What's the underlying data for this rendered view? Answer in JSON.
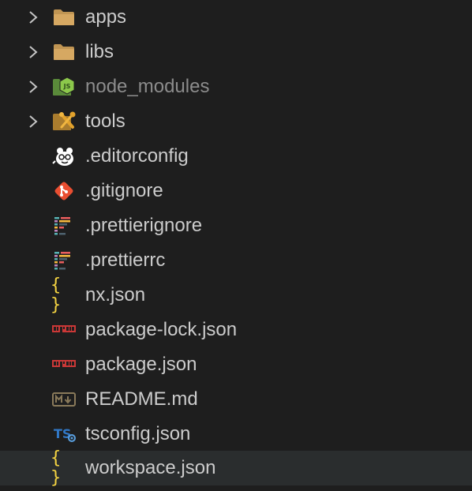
{
  "tree": {
    "items": [
      {
        "label": "apps",
        "kind": "folder",
        "icon": "folder-icon",
        "expandable": true,
        "dimmed": false,
        "selected": false
      },
      {
        "label": "libs",
        "kind": "folder",
        "icon": "folder-icon",
        "expandable": true,
        "dimmed": false,
        "selected": false
      },
      {
        "label": "node_modules",
        "kind": "folder",
        "icon": "node-folder-icon",
        "expandable": true,
        "dimmed": true,
        "selected": false
      },
      {
        "label": "tools",
        "kind": "folder",
        "icon": "tools-folder-icon",
        "expandable": true,
        "dimmed": false,
        "selected": false
      },
      {
        "label": ".editorconfig",
        "kind": "file",
        "icon": "editorconfig-icon",
        "expandable": false,
        "dimmed": false,
        "selected": false
      },
      {
        "label": ".gitignore",
        "kind": "file",
        "icon": "git-icon",
        "expandable": false,
        "dimmed": false,
        "selected": false
      },
      {
        "label": ".prettierignore",
        "kind": "file",
        "icon": "prettier-icon",
        "expandable": false,
        "dimmed": false,
        "selected": false
      },
      {
        "label": ".prettierrc",
        "kind": "file",
        "icon": "prettier-icon",
        "expandable": false,
        "dimmed": false,
        "selected": false
      },
      {
        "label": "nx.json",
        "kind": "file",
        "icon": "json-icon",
        "expandable": false,
        "dimmed": false,
        "selected": false
      },
      {
        "label": "package-lock.json",
        "kind": "file",
        "icon": "npm-icon",
        "expandable": false,
        "dimmed": false,
        "selected": false
      },
      {
        "label": "package.json",
        "kind": "file",
        "icon": "npm-icon",
        "expandable": false,
        "dimmed": false,
        "selected": false
      },
      {
        "label": "README.md",
        "kind": "file",
        "icon": "markdown-icon",
        "expandable": false,
        "dimmed": false,
        "selected": false
      },
      {
        "label": "tsconfig.json",
        "kind": "file",
        "icon": "tsconfig-icon",
        "expandable": false,
        "dimmed": false,
        "selected": false
      },
      {
        "label": "workspace.json",
        "kind": "file",
        "icon": "json-icon",
        "expandable": false,
        "dimmed": false,
        "selected": true
      }
    ]
  },
  "colors": {
    "background": "#1e1e1e",
    "selected_row": "#2a2d2e",
    "text": "#cccccc",
    "dimmed_text": "#8c8c8c",
    "folder": "#c09553",
    "json": "#f5d442",
    "npm": "#cb3837",
    "git": "#e94e31",
    "typescript": "#3178c6",
    "node": "#8cc84b"
  }
}
